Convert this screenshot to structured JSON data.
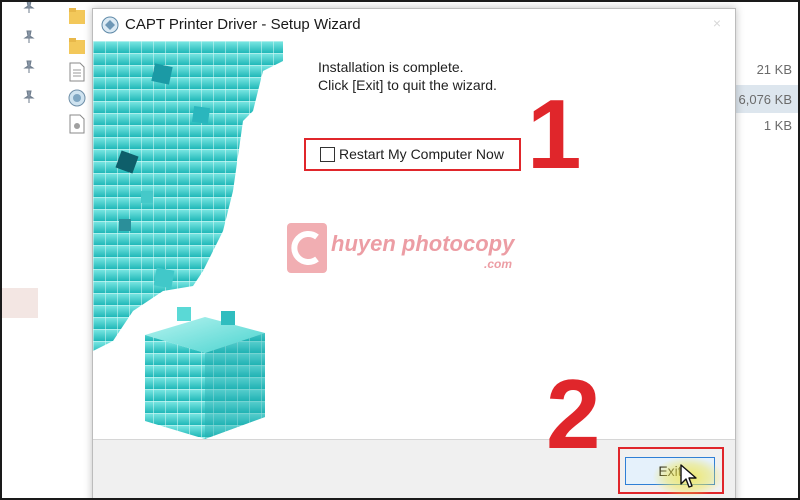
{
  "dialog": {
    "title": "CAPT Printer Driver - Setup Wizard",
    "close_glyph": "×",
    "message_line1": "Installation is complete.",
    "message_line2": "Click [Exit] to quit the wizard.",
    "restart_checkbox": {
      "label": "Restart My Computer Now",
      "checked": false
    },
    "exit_button_label": "Exit"
  },
  "background": {
    "file_sizes": [
      "21 KB",
      "6,076 KB",
      "1 KB"
    ]
  },
  "annotations": {
    "step1": "1",
    "step2": "2",
    "highlight_color": "#e0262b"
  },
  "watermark": {
    "text": "huyen photocopy",
    "suffix": ".com"
  },
  "icons": {
    "pin": "pin-icon",
    "folder": "folder-icon",
    "document": "document-icon",
    "setup": "setup-icon",
    "cursor": "mouse-cursor-icon"
  }
}
